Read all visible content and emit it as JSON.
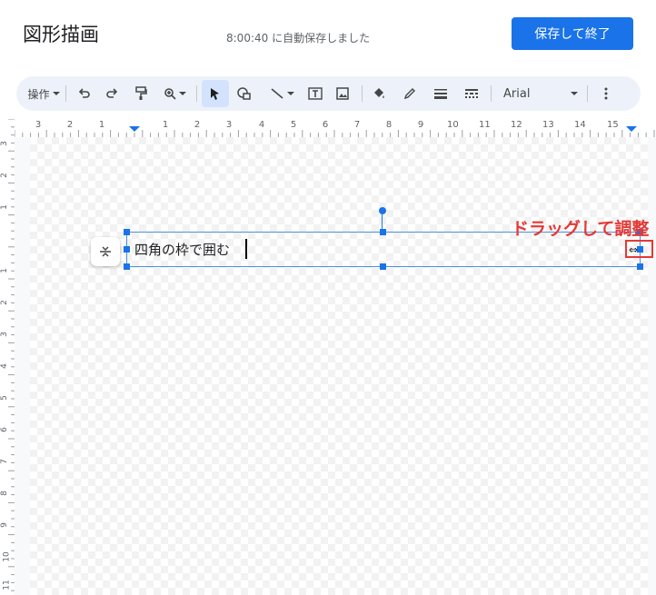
{
  "header": {
    "title": "図形描画",
    "autosave_status": "8:00:40 に自動保存しました",
    "save_close_label": "保存して終了"
  },
  "toolbar": {
    "actions_label": "操作",
    "font_name": "Arial",
    "icons": [
      "undo-icon",
      "redo-icon",
      "paint-format-icon",
      "zoom-icon",
      "select-icon",
      "shape-icon",
      "line-icon",
      "textbox-icon",
      "image-icon",
      "fill-color-icon",
      "pen-icon",
      "line-weight-icon",
      "line-dash-icon",
      "more-icon"
    ]
  },
  "ruler": {
    "horizontal_labels": [
      "3",
      "2",
      "1",
      "1",
      "2",
      "3",
      "4",
      "5",
      "6",
      "7",
      "8",
      "9",
      "10",
      "11",
      "12",
      "13",
      "14",
      "15"
    ],
    "vertical_labels": [
      "3",
      "2",
      "1",
      "1",
      "2",
      "3",
      "4",
      "5",
      "6",
      "7",
      "8",
      "9",
      "10",
      "11"
    ]
  },
  "canvas": {
    "textbox_text": "四角の枠で囲む",
    "annotation_text": "ドラッグして調整",
    "annotation_color": "#e53935",
    "selection_color": "#1a73e8"
  }
}
